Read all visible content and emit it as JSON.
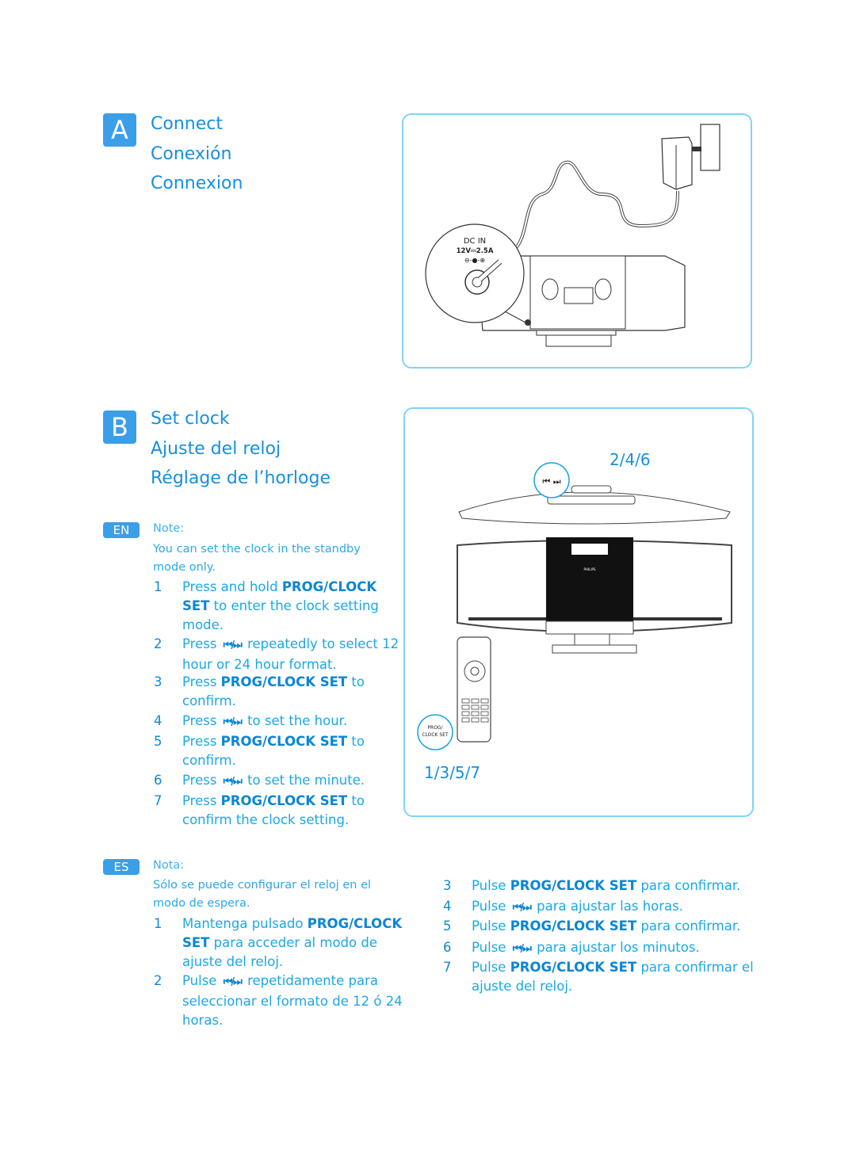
{
  "sectionA": {
    "badge": "A",
    "titles": [
      "Connect",
      "Conexión",
      "Connexion"
    ],
    "figure": {
      "label_dc": "DC IN",
      "label_rating": "12V⎓2.5A",
      "label_polarity": "⊖-●-⊕"
    }
  },
  "sectionB": {
    "badge": "B",
    "titles": [
      "Set clock",
      "Ajuste del reloj",
      "Réglage de l’horloge"
    ],
    "figure": {
      "callout_top": "2/4/6",
      "callout_skip": "⏮ ⏭",
      "callout_remote": "PROG/ CLOCK SET",
      "callout_bottom": "1/3/5/7",
      "brand": "PHILIPS"
    },
    "en": {
      "badge": "EN",
      "note_title": "Note:",
      "note_body": "You can set the clock in the standby mode only.",
      "steps": [
        {
          "num": "1",
          "pre": "Press and hold ",
          "bold": "PROG/CLOCK SET",
          "post": " to enter the clock setting mode.",
          "icon": ""
        },
        {
          "num": "2",
          "pre": "Press ",
          "bold": "",
          "post": " repeatedly to select 12 hour or 24 hour format.",
          "icon": "⏮/⏭"
        },
        {
          "num": "3",
          "pre": "Press ",
          "bold": "PROG/CLOCK SET",
          "post": " to confirm.",
          "icon": ""
        },
        {
          "num": "4",
          "pre": "Press ",
          "bold": "",
          "post": " to set the hour.",
          "icon": "⏮/⏭"
        },
        {
          "num": "5",
          "pre": "Press ",
          "bold": "PROG/CLOCK SET",
          "post": " to confirm.",
          "icon": ""
        },
        {
          "num": "6",
          "pre": "Press ",
          "bold": "",
          "post": " to set the minute.",
          "icon": "⏮/⏭"
        },
        {
          "num": "7",
          "pre": "Press ",
          "bold": "PROG/CLOCK SET",
          "post": " to confirm the clock setting.",
          "icon": ""
        }
      ]
    },
    "es": {
      "badge": "ES",
      "note_title": "Nota:",
      "note_body": "Sólo se puede configurar el reloj en el modo de espera.",
      "steps": [
        {
          "num": "1",
          "pre": "Mantenga pulsado ",
          "bold": "PROG/CLOCK SET",
          "post": " para acceder al modo de ajuste del reloj.",
          "icon": ""
        },
        {
          "num": "2",
          "pre": "Pulse ",
          "bold": "",
          "post": " repetidamente para seleccionar el formato de 12 ó 24 horas.",
          "icon": "⏮/⏭"
        },
        {
          "num": "3",
          "pre": "Pulse ",
          "bold": "PROG/CLOCK SET",
          "post": " para confirmar.",
          "icon": ""
        },
        {
          "num": "4",
          "pre": "Pulse ",
          "bold": "",
          "post": " para ajustar las horas.",
          "icon": "⏮/⏭"
        },
        {
          "num": "5",
          "pre": "Pulse ",
          "bold": "PROG/CLOCK SET",
          "post": " para confirmar.",
          "icon": ""
        },
        {
          "num": "6",
          "pre": "Pulse ",
          "bold": "",
          "post": " para ajustar los minutos.",
          "icon": "⏮/⏭"
        },
        {
          "num": "7",
          "pre": "Pulse ",
          "bold": "PROG/CLOCK SET",
          "post": " para confirmar el ajuste del reloj.",
          "icon": ""
        }
      ]
    }
  }
}
